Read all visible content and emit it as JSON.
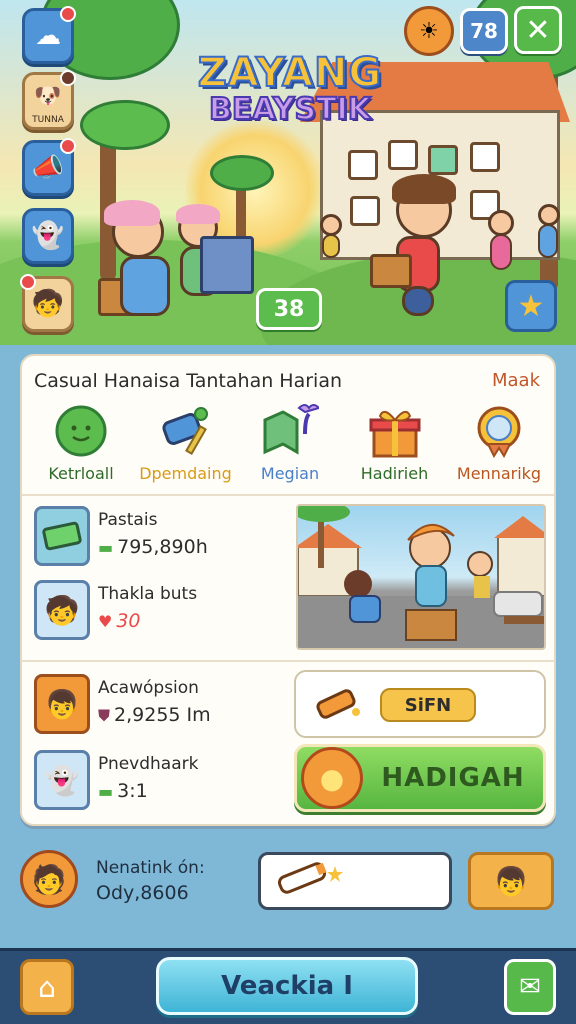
{
  "hero": {
    "title_line1": "ZAYANG",
    "title_line2": "BEAYSTIK",
    "side_label_2": "TUNNA",
    "counter": "78",
    "close_symbol": "✕",
    "score": "38",
    "star_symbol": "★"
  },
  "panel": {
    "title": "Casual Hanaisa Tantahan Harian",
    "more_label": "Maak",
    "categories": [
      {
        "label": "Ketrloall",
        "color": "#2f6b2a",
        "icon": "bush-icon"
      },
      {
        "label": "Dpemdaing",
        "color": "#d99a16",
        "icon": "telescope-icon"
      },
      {
        "label": "Megian",
        "color": "#4a7fc7",
        "icon": "map-icon"
      },
      {
        "label": "Hadirieh",
        "color": "#2f6b2a",
        "icon": "gift-icon"
      },
      {
        "label": "Mennarikg",
        "color": "#b8561f",
        "icon": "badge-icon"
      }
    ],
    "items": [
      {
        "title": "Pastais",
        "value": "795,890h",
        "icon": "ticket-icon"
      },
      {
        "title": "Thakla buts",
        "value": "30",
        "icon": "kid-avatar-icon"
      },
      {
        "title": "Acawópsion",
        "value": "2,9255 Im",
        "icon": "boy-avatar-icon"
      },
      {
        "title": "Pnevdhaark",
        "value": "3:1",
        "icon": "ghost-icon"
      }
    ],
    "sign_label": "SiFN",
    "hadiah_label": "HADIGAH"
  },
  "footer": {
    "net_label": "Nenatink ón:",
    "net_value": "Ody,8606"
  },
  "nav": {
    "main_label": "Veackia I"
  },
  "colors": {
    "accent_green": "#58b94b",
    "accent_blue": "#4f95d8",
    "accent_orange": "#f4b34a",
    "nav_bg": "#2d4e74"
  }
}
